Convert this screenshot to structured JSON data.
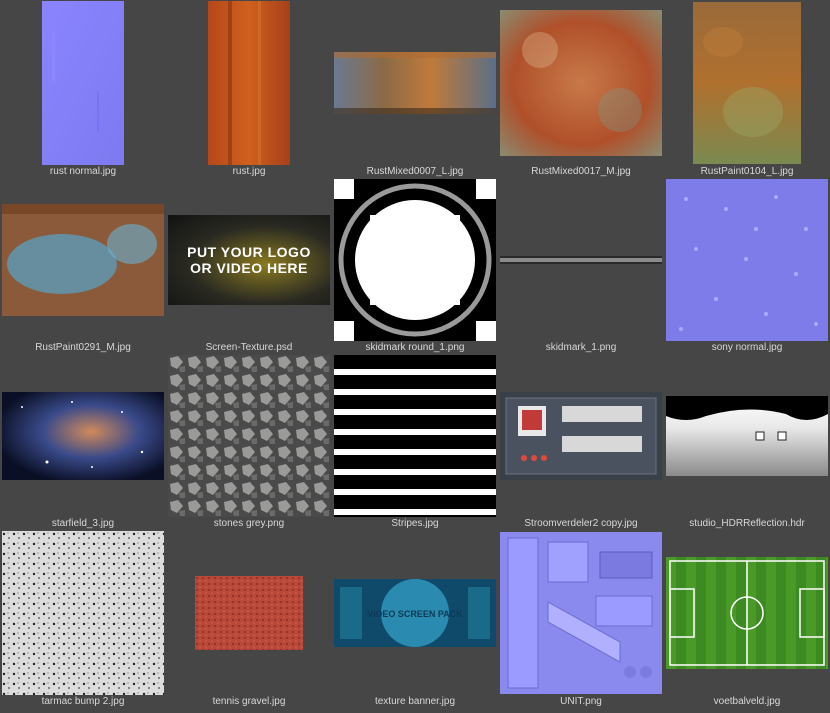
{
  "files": [
    {
      "name": "rust normal.jpg"
    },
    {
      "name": "rust.jpg"
    },
    {
      "name": "RustMixed0007_L.jpg"
    },
    {
      "name": "RustMixed0017_M.jpg"
    },
    {
      "name": "RustPaint0104_L.jpg"
    },
    {
      "name": "RustPaint0291_M.jpg"
    },
    {
      "name": "Screen-Texture.psd",
      "overlay_text": "PUT YOUR LOGO OR VIDEO HERE"
    },
    {
      "name": "skidmark round_1.png"
    },
    {
      "name": "skidmark_1.png"
    },
    {
      "name": "sony normal.jpg"
    },
    {
      "name": "starfield_3.jpg"
    },
    {
      "name": "stones grey.png"
    },
    {
      "name": "Stripes.jpg"
    },
    {
      "name": "Stroomverdeler2 copy.jpg"
    },
    {
      "name": "studio_HDRReflection.hdr"
    },
    {
      "name": "tarmac bump 2.jpg"
    },
    {
      "name": "tennis gravel.jpg"
    },
    {
      "name": "texture banner.jpg",
      "overlay_text": "VIDEO SCREEN PACK"
    },
    {
      "name": "UNIT.png"
    },
    {
      "name": "voetbalveld.jpg"
    }
  ]
}
